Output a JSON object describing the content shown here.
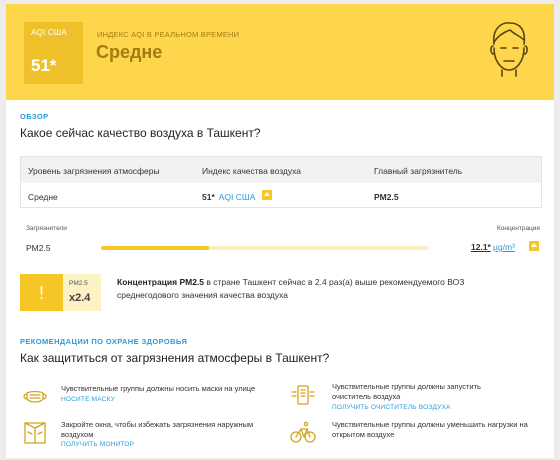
{
  "header": {
    "aqi_label": "AQI США",
    "aqi_value": "51*",
    "realtime_label": "ИНДЕКС AQI В РЕАЛЬНОМ ВРЕМЕНИ",
    "status": "Средне",
    "face_icon": "face-moderate-icon",
    "colors": {
      "background": "#fdd64b",
      "aqi_box": "#eec12a",
      "status_text": "#a57a13"
    }
  },
  "overview": {
    "tag": "ОБЗОР",
    "title": "Какое сейчас качество воздуха в Ташкент?",
    "table": {
      "headers": [
        "Уровень загрязнения атмосферы",
        "Индекс качества воздуха",
        "Главный загрязнитель"
      ],
      "row": {
        "level": "Средне",
        "aqi_value": "51*",
        "aqi_unit": "AQI США",
        "main_pollutant": "PM2.5"
      }
    }
  },
  "pollutants": {
    "header_left": "Загрязнители",
    "header_right": "Концентрация",
    "items": [
      {
        "name": "PM2.5",
        "value": "12.1*",
        "unit": "µg/m³",
        "level_fraction": 0.33,
        "trend_icon": "arrow-up-icon"
      }
    ],
    "colors": {
      "bar_fill": "#f5c625",
      "bar_track": "#fbefc1"
    }
  },
  "concentration_note": {
    "pm_label": "PM2.5",
    "multiplier": "x2.4",
    "text_bold": "Концентрация PM2.5",
    "text_rest": " в стране Ташкент сейчас в 2.4 раз(а) выше рекомендуемого ВОЗ среднегодового значения качества воздуха"
  },
  "recommendations": {
    "tag": "РЕКОМЕНДАЦИИ ПО ОХРАНЕ ЗДОРОВЬЯ",
    "title": "Как защититься от загрязнения атмосферы в Ташкент?",
    "items": [
      {
        "icon": "mask-icon",
        "text": "Чувствительные группы должны носить маски на улице",
        "link": "НОСИТЕ МАСКУ"
      },
      {
        "icon": "air-purifier-icon",
        "text": "Чувствительные группы должны запустить очиститель воздуха",
        "link": "ПОЛУЧИТЬ ОЧИСТИТЕЛЬ ВОЗДУХА"
      },
      {
        "icon": "closed-window-icon",
        "text": "Закройте окна, чтобы избежать загрязнения наружным воздухом",
        "link": "ПОЛУЧИТЬ МОНИТОР"
      },
      {
        "icon": "bicycle-icon",
        "text": "Чувствительные группы должны уменьшить нагрузки на открытом воздухе",
        "link": ""
      }
    ]
  }
}
